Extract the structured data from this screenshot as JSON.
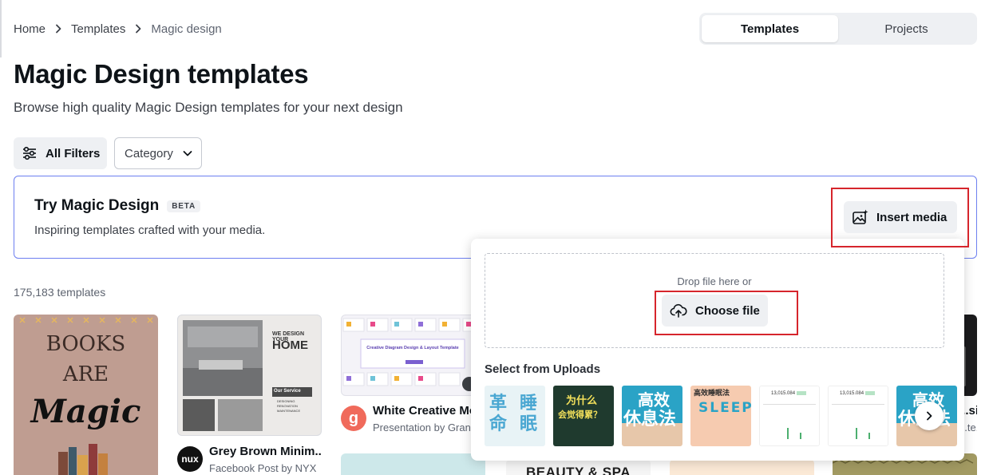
{
  "breadcrumb": {
    "home": "Home",
    "templates": "Templates",
    "current": "Magic design"
  },
  "view_toggle": {
    "templates": "Templates",
    "projects": "Projects",
    "selected": "Templates"
  },
  "page": {
    "title": "Magic Design templates",
    "subtitle": "Browse high quality Magic Design templates for your next design"
  },
  "filters": {
    "all_filters": "All Filters",
    "category": "Category"
  },
  "magic_card": {
    "title": "Try Magic Design",
    "badge": "BETA",
    "subtitle": "Inspiring templates crafted with your media.",
    "insert_media": "Insert media"
  },
  "template_count": "175,183 templates",
  "templates": [
    {
      "name": "",
      "meta": "",
      "thumb_text": [
        "BOOKS",
        "ARE",
        "Magic"
      ]
    },
    {
      "name": "Grey Brown Minim...",
      "meta": "Facebook Post by NYX",
      "avatar": "nux",
      "thumb_text": [
        "WE DESIGN YOUR",
        "HOME",
        "Our Service",
        "DESIGNING",
        "RENOVATION",
        "MAINTENANCE"
      ]
    },
    {
      "name": "White Creative Mo",
      "meta": "Presentation by Gran",
      "avatar": "g",
      "thumb_text": [
        "Creative Diagram Design & Layout Template"
      ]
    },
    {
      "name": "",
      "meta": "",
      "thumb_text": [
        "BEAUTY & SPA"
      ]
    },
    {
      "name": "...si...",
      "meta": "...te..."
    }
  ],
  "popover": {
    "drop_text": "Drop file here or",
    "choose_file": "Choose file",
    "uploads_label": "Select from Uploads",
    "uploads": [
      {
        "text": [
          "革",
          "睡",
          "命",
          "眠"
        ],
        "bg": "#e8f3f6",
        "fg": "#4aa7d2"
      },
      {
        "text": [
          "为什么",
          "会觉得累？"
        ],
        "bg": "#1f3a2e",
        "fg": "#f4e15b"
      },
      {
        "text": [
          "高效",
          "休息法"
        ],
        "bg": "#2aa3c6",
        "fg": "#ffffff"
      },
      {
        "text": [
          "高效睡眠法",
          "SLEEP"
        ],
        "bg": "#f6cbb0",
        "fg": "#2a2a2a"
      },
      {
        "text": [
          "13,015.084"
        ],
        "bg": "#ffffff",
        "fg": "#333333"
      },
      {
        "text": [
          "13,015.084"
        ],
        "bg": "#ffffff",
        "fg": "#333333"
      },
      {
        "text": [
          "高效",
          "休息法"
        ],
        "bg": "#2aa3c6",
        "fg": "#ffffff"
      }
    ]
  },
  "colors": {
    "accent_border": "#6d7ff0",
    "highlight": "#d6252c",
    "surface": "#eef0f3"
  }
}
